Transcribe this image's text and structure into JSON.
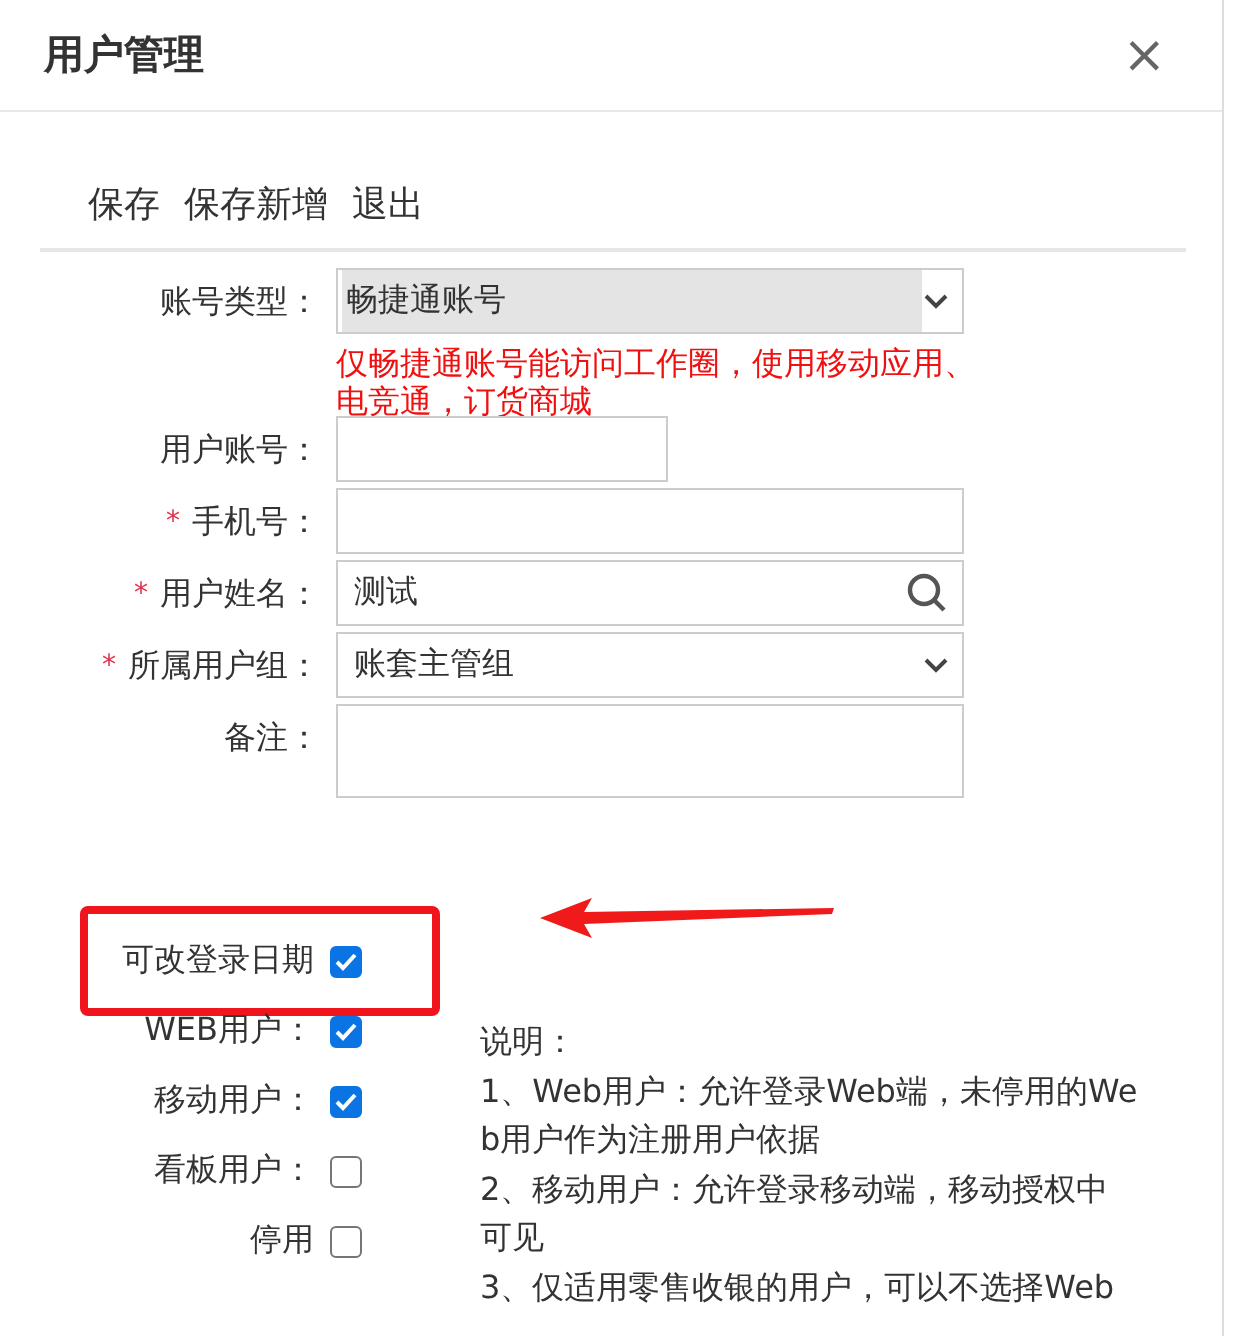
{
  "dialog": {
    "title": "用户管理",
    "close": "×"
  },
  "toolbar": [
    "保存",
    "保存新增",
    "退出"
  ],
  "fields": [
    {
      "label": "账号类型：",
      "kind": "select",
      "disabled": true,
      "value": "畅捷通账号",
      "note": [
        "仅畅捷通账号能访问工作圈，使用移动应用、",
        "电竞通，订货商城"
      ]
    },
    {
      "label": "用户账号：",
      "kind": "short"
    },
    {
      "label": "手机号：",
      "required_mark": "*",
      "kind": "text"
    },
    {
      "label": "用户姓名：",
      "required_mark": "*",
      "kind": "search",
      "value": "测试"
    },
    {
      "label": "所属用户组：",
      "required_mark": "*",
      "kind": "select",
      "disabled": false,
      "value": "账套主管组"
    },
    {
      "label": "备注：",
      "kind": "textarea"
    }
  ],
  "checks": [
    {
      "label": "可改登录日期",
      "checked": true,
      "highlighted": true
    },
    {
      "label": "WEB用户：",
      "checked": true,
      "highlighted": false
    },
    {
      "label": "移动用户：",
      "checked": true,
      "highlighted": false
    },
    {
      "label": "看板用户：",
      "checked": false,
      "highlighted": false
    },
    {
      "label": "停用",
      "checked": false,
      "highlighted": false
    }
  ],
  "note": {
    "title": "说明：",
    "lines": [
      "1、Web用户：允许登录Web端，未停用的Web用户作为注册用户依据",
      "2、移动用户：允许登录移动端，移动授权中可见",
      "3、仅适用零售收银的用户，可以不选择Web"
    ]
  }
}
